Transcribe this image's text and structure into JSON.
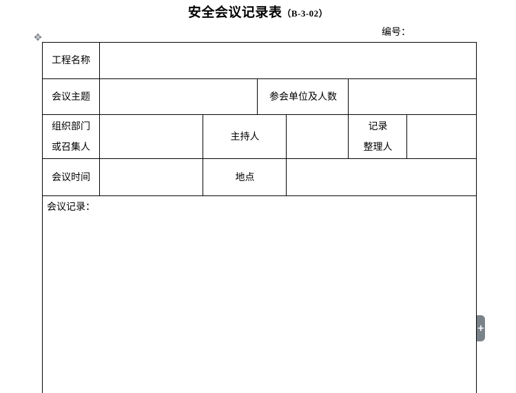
{
  "document": {
    "title": "安全会议记录表",
    "form_code": "（B-3-02）",
    "serial_label": "编号：",
    "serial_value": ""
  },
  "form": {
    "project_name_label": "工程名称",
    "project_name_value": "",
    "meeting_topic_label": "会议主题",
    "meeting_topic_value": "",
    "attendees_label": "参会单位及人数",
    "attendees_value": "",
    "organizer_label_line1": "组织部门",
    "organizer_label_line2": "或召集人",
    "organizer_value": "",
    "host_label": "主持人",
    "host_value": "",
    "recorder_label_line1": "记录",
    "recorder_label_line2": "整理人",
    "recorder_value": "",
    "meeting_time_label": "会议时间",
    "meeting_time_value": "",
    "location_label": "地点",
    "location_value": "",
    "minutes_label": "会议记录：",
    "minutes_value": ""
  },
  "icons": {
    "table_move_handle": "move-icon",
    "side_expand_tab": "plus-icon"
  }
}
